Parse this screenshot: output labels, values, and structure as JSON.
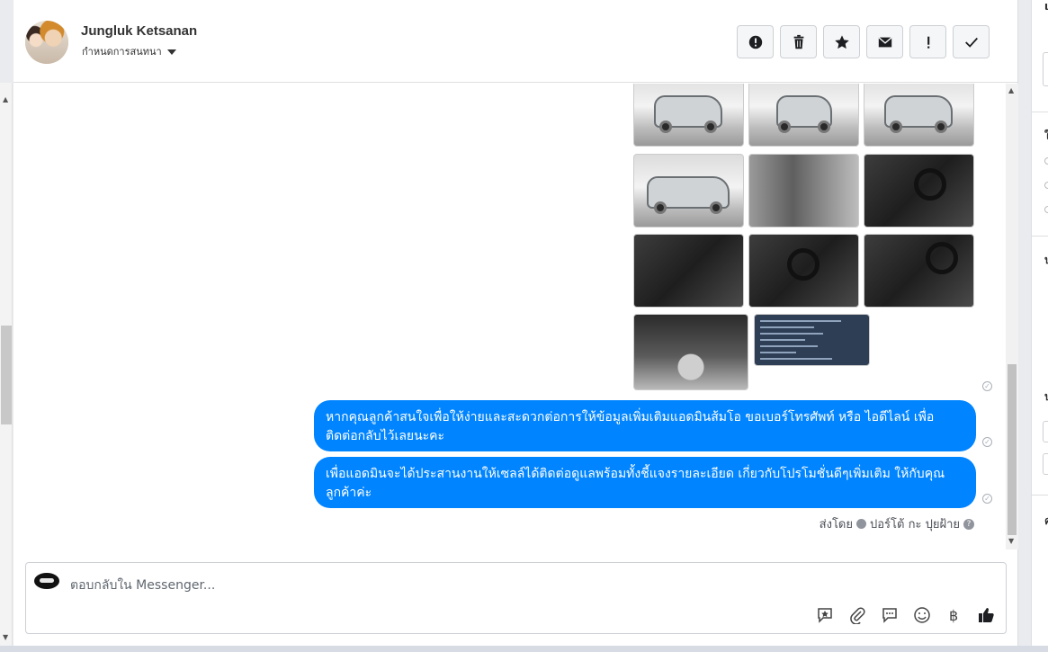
{
  "contact": {
    "name": "Jungluk Ketsanan",
    "subtitle": "กำหนดการสนทนา"
  },
  "header_actions": [
    {
      "name": "report-spam-button",
      "icon": "alert-circle-icon"
    },
    {
      "name": "delete-button",
      "icon": "trash-icon"
    },
    {
      "name": "star-button",
      "icon": "star-icon"
    },
    {
      "name": "mark-unread-button",
      "icon": "envelope-icon"
    },
    {
      "name": "important-button",
      "icon": "exclamation-icon"
    },
    {
      "name": "done-button",
      "icon": "checkmark-icon"
    }
  ],
  "messages": [
    "หากคุณลูกค้าสนใจเพื่อให้ง่ายและสะดวกต่อการให้ข้อมูลเพิ่มเติมแอดมินส้มโอ ขอเบอร์โทรศัพท์ หรือ ไอดีไลน์ เพื่อติดต่อกลับไว้เลยนะคะ",
    "เพื่อแอดมินจะได้ประสานงานให้เซลล์ได้ติดต่อดูแลพร้อมทั้งชี้แจงรายละเอียด เกี่ยวกับโปรโมชั่นดีๆเพิ่มเติม ให้กับคุณลูกค้าค่ะ"
  ],
  "sent_by": {
    "prefix": "ส่งโดย",
    "sender": "ปอร์โต้ กะ ปุยฝ้าย"
  },
  "composer": {
    "placeholder": "ตอบกลับใน Messenger..."
  },
  "composer_tools": [
    {
      "name": "saved-reply-icon"
    },
    {
      "name": "attachment-icon"
    },
    {
      "name": "chat-bubble-icon"
    },
    {
      "name": "emoji-icon"
    },
    {
      "name": "baht-payment-icon"
    },
    {
      "name": "thumbs-up-icon"
    }
  ],
  "colors": {
    "bubble": "#0084ff",
    "header_border": "#dddfe2"
  }
}
